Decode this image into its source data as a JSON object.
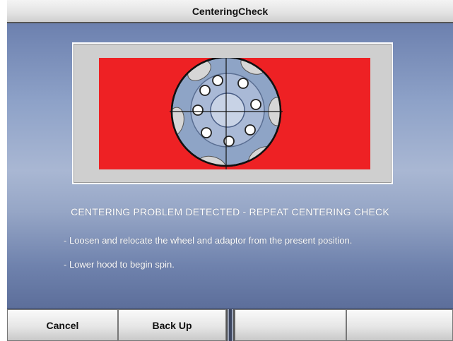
{
  "window": {
    "title": "CenteringCheck"
  },
  "message": {
    "heading": "CENTERING PROBLEM DETECTED - REPEAT CENTERING CHECK",
    "instructions": [
      "- Loosen and relocate the wheel and adaptor from the present position.",
      "- Lower hood to begin spin."
    ]
  },
  "buttons": {
    "cancel": "Cancel",
    "back_up": "Back Up",
    "softkey3": "",
    "softkey4": ""
  },
  "colors": {
    "alert_background": "#ee2124",
    "wheel_fill": "#8ea4c6",
    "screen_background": "#8ea2c8"
  }
}
